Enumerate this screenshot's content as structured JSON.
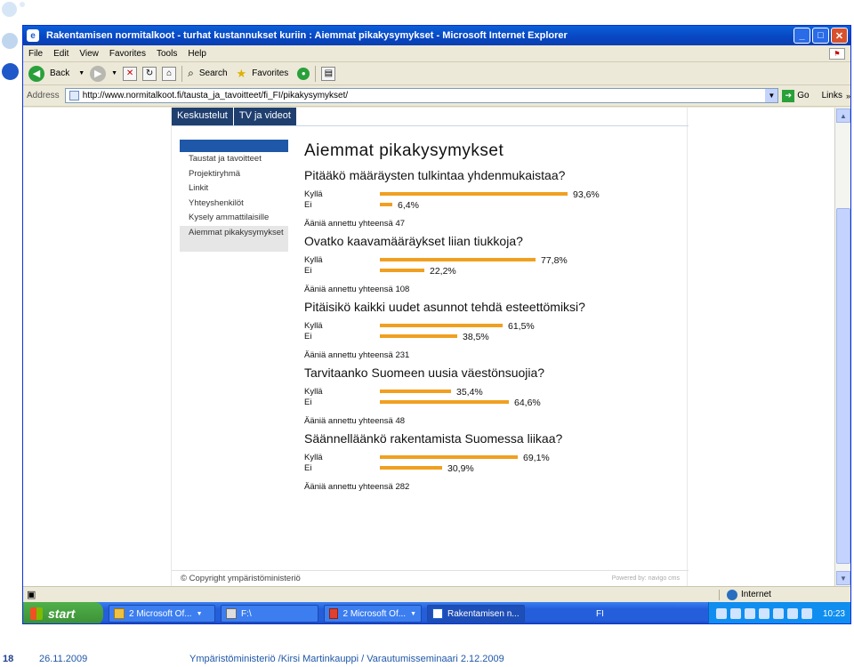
{
  "window": {
    "title": "Rakentamisen normitalkoot - turhat kustannukset kuriin : Aiemmat pikakysymykset - Microsoft Internet Explorer",
    "minimize": "_",
    "maximize": "□",
    "close": "✕"
  },
  "menu": [
    "File",
    "Edit",
    "View",
    "Favorites",
    "Tools",
    "Help"
  ],
  "toolbar": {
    "back": "Back",
    "search": "Search",
    "favorites": "Favorites"
  },
  "address": {
    "label": "Address",
    "url": "http://www.normitalkoot.fi/tausta_ja_tavoitteet/fi_FI/pikakysymykset/",
    "go": "Go",
    "links": "Links"
  },
  "site": {
    "topnav": [
      "Keskustelut",
      "TV ja videot"
    ],
    "sidenav": [
      "Taustat ja tavoitteet",
      "Projektiryhmä",
      "Linkit",
      "Yhteyshenkilöt",
      "Kysely ammattilaisille",
      "Aiemmat pikakysymykset"
    ],
    "heading": "Aiemmat pikakysymykset",
    "yes_label": "Kyllä",
    "no_label": "Ei",
    "polls": [
      {
        "question": "Pitääkö määräysten tulkintaa yhdenmukaistaa?",
        "yes_pct": "93,6%",
        "no_pct": "6,4%",
        "yes_value": 93.6,
        "no_value": 6.4,
        "total": "Ääniä annettu yhteensä 47"
      },
      {
        "question": "Ovatko kaavamääräykset liian tiukkoja?",
        "yes_pct": "77,8%",
        "no_pct": "22,2%",
        "yes_value": 77.8,
        "no_value": 22.2,
        "total": "Ääniä annettu yhteensä 108"
      },
      {
        "question": "Pitäisikö kaikki uudet asunnot tehdä esteettömiksi?",
        "yes_pct": "61,5%",
        "no_pct": "38,5%",
        "yes_value": 61.5,
        "no_value": 38.5,
        "total": "Ääniä annettu yhteensä 231"
      },
      {
        "question": "Tarvitaanko Suomeen uusia väestönsuojia?",
        "yes_pct": "35,4%",
        "no_pct": "64,6%",
        "yes_value": 35.4,
        "no_value": 64.6,
        "total": "Ääniä annettu yhteensä 48"
      },
      {
        "question": "Säännelläänkö rakentamista Suomessa liikaa?",
        "yes_pct": "69,1%",
        "no_pct": "30,9%",
        "yes_value": 69.1,
        "no_value": 30.9,
        "total": "Ääniä annettu yhteensä 282"
      }
    ],
    "bar_color": "#f0a020",
    "copyright": "© Copyright ympäristöministeriö",
    "powered": "Powered by: navigo cms"
  },
  "statusbar": {
    "zone": "Internet"
  },
  "taskbar": {
    "start": "start",
    "tasks": [
      "2 Microsoft Of...",
      "F:\\",
      "2 Microsoft Of...",
      "Rakentamisen n..."
    ],
    "lang": "FI",
    "clock": "10:23"
  },
  "slide": {
    "page_number": "18",
    "date": "26.11.2009",
    "footer": "Ympäristöministeriö /Kirsi Martinkauppi / Varautumisseminaari 2.12.2009"
  }
}
